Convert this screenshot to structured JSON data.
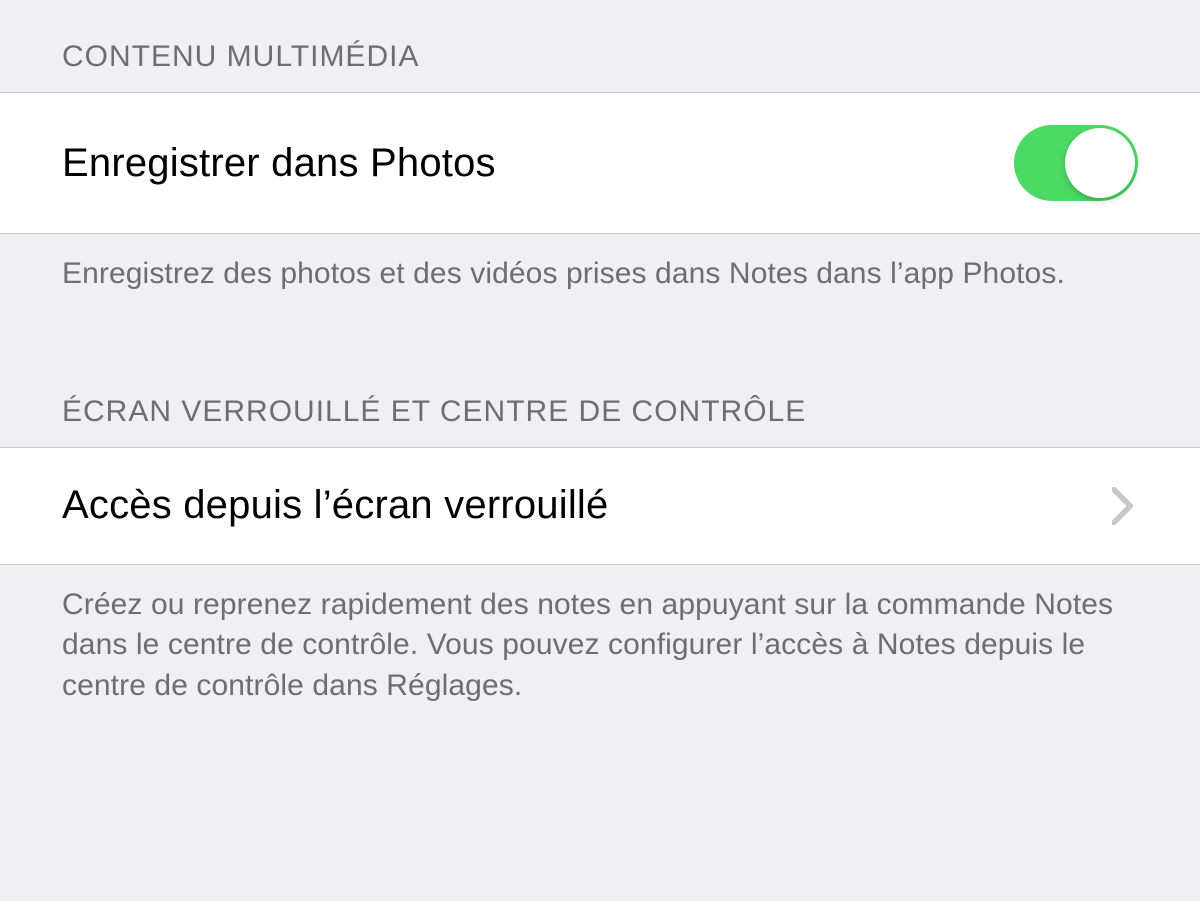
{
  "section1": {
    "header": "CONTENU MULTIMÉDIA",
    "row": {
      "label": "Enregistrer dans Photos",
      "switch_on": "true"
    },
    "footer": "Enregistrez des photos et des vidéos prises dans Notes dans l’app Photos."
  },
  "section2": {
    "header": "ÉCRAN VERROUILLÉ ET CENTRE DE CONTRÔLE",
    "row": {
      "label": "Accès depuis l’écran verrouillé"
    },
    "footer": "Créez ou reprenez rapidement des notes en appuyant sur la commande Notes dans le centre de contrôle. Vous pouvez configurer l’accès à Notes depuis le centre de contrôle dans Réglages."
  }
}
